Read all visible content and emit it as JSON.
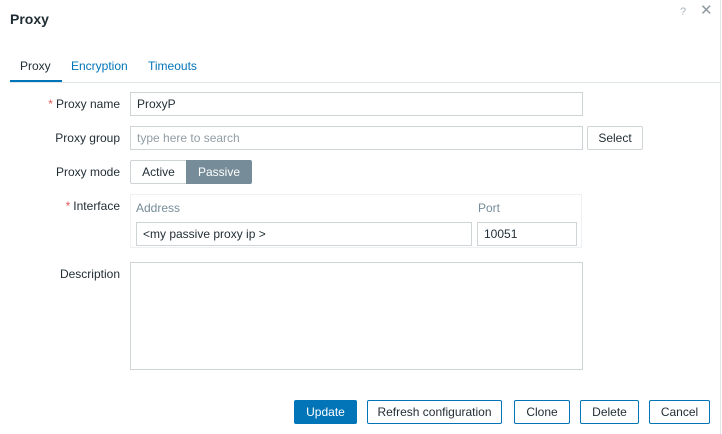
{
  "dialog": {
    "title": "Proxy",
    "help_glyph": "?",
    "close_glyph": "✕"
  },
  "tabs": [
    {
      "label": "Proxy",
      "active": true
    },
    {
      "label": "Encryption",
      "active": false
    },
    {
      "label": "Timeouts",
      "active": false
    }
  ],
  "form": {
    "required_marker": "*",
    "proxy_name": {
      "label": "Proxy name",
      "value": "ProxyP"
    },
    "proxy_group": {
      "label": "Proxy group",
      "placeholder": "type here to search",
      "select_label": "Select"
    },
    "proxy_mode": {
      "label": "Proxy mode",
      "options": [
        "Active",
        "Passive"
      ],
      "selected": "Passive"
    },
    "interface": {
      "label": "Interface",
      "address_header": "Address",
      "port_header": "Port",
      "address_value": "<my passive proxy ip >",
      "port_value": "10051"
    },
    "description": {
      "label": "Description",
      "value": ""
    }
  },
  "footer": {
    "update": "Update",
    "refresh": "Refresh configuration",
    "clone": "Clone",
    "delete": "Delete",
    "cancel": "Cancel"
  },
  "colors": {
    "accent": "#0275b8",
    "selected_segment": "#768d99",
    "required": "#e45959"
  },
  "icons": {
    "help": "help-icon",
    "close": "close-icon",
    "resize": "resize-handle-icon"
  }
}
